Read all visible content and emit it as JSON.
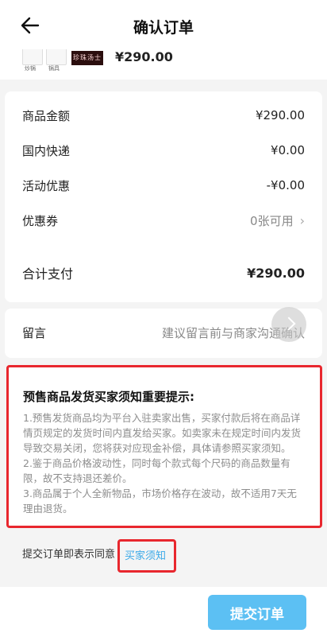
{
  "header": {
    "title": "确认订单"
  },
  "product": {
    "thumbs": [
      "炒锅",
      "锅具"
    ],
    "thumb_dark_text": "珍珠汤士",
    "price": "¥290.00"
  },
  "summary": {
    "items": [
      {
        "label": "商品金额",
        "value": "¥290.00"
      },
      {
        "label": "国内快递",
        "value": "¥0.00"
      },
      {
        "label": "活动优惠",
        "value": "-¥0.00"
      },
      {
        "label": "优惠券",
        "value": "0张可用"
      }
    ],
    "total": {
      "label": "合计支付",
      "value": "¥290.00"
    }
  },
  "note": {
    "label": "留言",
    "placeholder": "建议留言前与商家沟通确认"
  },
  "notice": {
    "title": "预售商品发货买家须知重要提示:",
    "paragraphs": [
      "1.预售发货商品均为平台入驻卖家出售，买家付款后将在商品详情页规定的发货时间内直发给买家。如卖家未在规定时间内发货导致交易关闭，您将获对应现金补偿，具体请参照买家须知。",
      "2.鉴于商品价格波动性，同时每个款式每个尺码的商品数量有限，故不支持退还差价。",
      "3.商品属于个人全新物品，市场价格存在波动，故不适用7天无理由退货。"
    ]
  },
  "agree": {
    "text": "提交订单即表示同意",
    "link": "买家须知"
  },
  "submit": {
    "label": "提交订单"
  },
  "colors": {
    "accent": "#5cc0f3",
    "highlight": "#e8272e",
    "link": "#3aa9e8"
  },
  "icons": {
    "back": "arrow-left-icon",
    "coupon": "chevron-right-icon",
    "fab": "chevron-right-icon"
  }
}
